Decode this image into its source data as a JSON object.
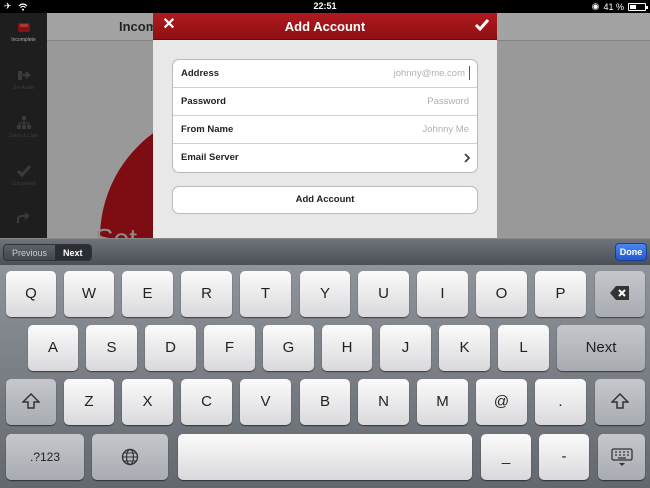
{
  "statusbar": {
    "time": "22:51",
    "battery": "41 %",
    "battery_level": 0.41
  },
  "app": {
    "header_title": "Incom",
    "ghost_text": "Set",
    "sidebar": [
      {
        "label": "Incomplete",
        "icon": "inbox-icon",
        "active": true
      },
      {
        "label": "Set Aside",
        "icon": "set-aside-icon",
        "active": false
      },
      {
        "label": "Dates & Lists",
        "icon": "hierarchy-icon",
        "active": false
      },
      {
        "label": "Completed",
        "icon": "checkmark-icon",
        "active": false
      },
      {
        "label": "",
        "icon": "share-icon",
        "active": false
      }
    ],
    "accent": "#b3141b"
  },
  "modal": {
    "title": "Add Account",
    "fields": [
      {
        "label": "Address",
        "placeholder": "johnny@me.com"
      },
      {
        "label": "Password",
        "placeholder": "Password"
      },
      {
        "label": "From Name",
        "placeholder": "Johnny Me"
      },
      {
        "label": "Email Server",
        "placeholder": ""
      }
    ],
    "add_button": "Add Account"
  },
  "assist": {
    "previous": "Previous",
    "next": "Next",
    "done": "Done"
  },
  "keyboard": {
    "row1": [
      "Q",
      "W",
      "E",
      "R",
      "T",
      "Y",
      "U",
      "I",
      "O",
      "P"
    ],
    "row2": [
      "A",
      "S",
      "D",
      "F",
      "G",
      "H",
      "J",
      "K",
      "L"
    ],
    "row2_return": "Next",
    "row3": [
      "Z",
      "X",
      "C",
      "V",
      "B",
      "N",
      "M",
      "@",
      "."
    ],
    "row4": {
      "numbers": ".?123",
      "underscore": "_",
      "dash": "-"
    }
  }
}
